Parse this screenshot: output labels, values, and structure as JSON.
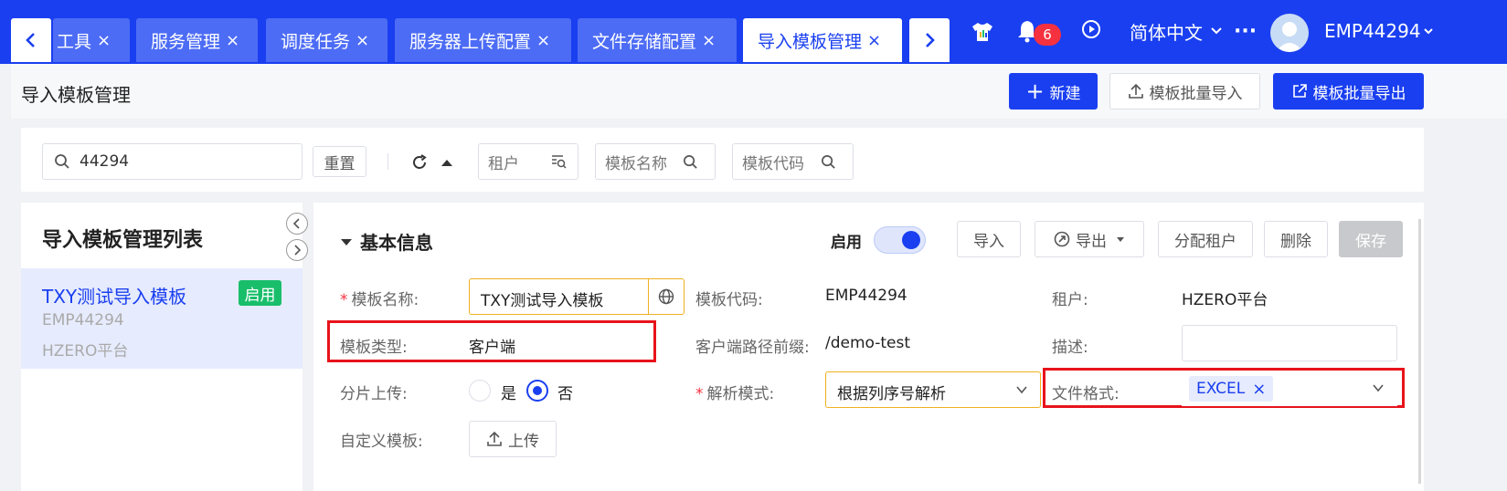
{
  "tabs": [
    {
      "label": "工具"
    },
    {
      "label": "服务管理"
    },
    {
      "label": "调度任务"
    },
    {
      "label": "服务器上传配置"
    },
    {
      "label": "文件存储配置"
    },
    {
      "label": "导入模板管理",
      "active": true
    }
  ],
  "tab_close": "×",
  "header": {
    "notification_count": "6",
    "language": "简体中文",
    "more": "···",
    "username": "EMP44294"
  },
  "page": {
    "title": "导入模板管理",
    "new_label": "新建",
    "batch_import_label": "模板批量导入",
    "batch_export_label": "模板批量导出"
  },
  "filters": {
    "search_value": "44294",
    "reset_label": "重置",
    "tenant_placeholder": "租户",
    "name_placeholder": "模板名称",
    "code_placeholder": "模板代码"
  },
  "list": {
    "title": "导入模板管理列表",
    "items": [
      {
        "name": "TXY测试导入模板",
        "code": "EMP44294",
        "tenant": "HZERO平台",
        "status": "启用"
      }
    ]
  },
  "detail": {
    "section_title": "基本信息",
    "enable_label": "启用",
    "enabled": true,
    "buttons": {
      "import": "导入",
      "export": "导出",
      "assign": "分配租户",
      "delete": "删除",
      "save": "保存"
    },
    "fields": {
      "template_name_label": "模板名称:",
      "template_name_value": "TXY测试导入模板",
      "template_code_label": "模板代码:",
      "template_code_value": "EMP44294",
      "tenant_label": "租户:",
      "tenant_value": "HZERO平台",
      "template_type_label": "模板类型:",
      "template_type_value": "客户端",
      "client_prefix_label": "客户端路径前缀:",
      "client_prefix_value": "/demo-test",
      "description_label": "描述:",
      "shard_upload_label": "分片上传:",
      "shard_yes": "是",
      "shard_no": "否",
      "shard_selected": "否",
      "parse_mode_label": "解析模式:",
      "parse_mode_value": "根据列序号解析",
      "file_format_label": "文件格式:",
      "file_format_tag": "EXCEL",
      "custom_template_label": "自定义模板:",
      "upload_label": "上传"
    }
  },
  "colors": {
    "brand": "#1a3ff0",
    "highlight": "#e8131a",
    "status_enabled": "#19be6b",
    "required": "#f5313f"
  }
}
